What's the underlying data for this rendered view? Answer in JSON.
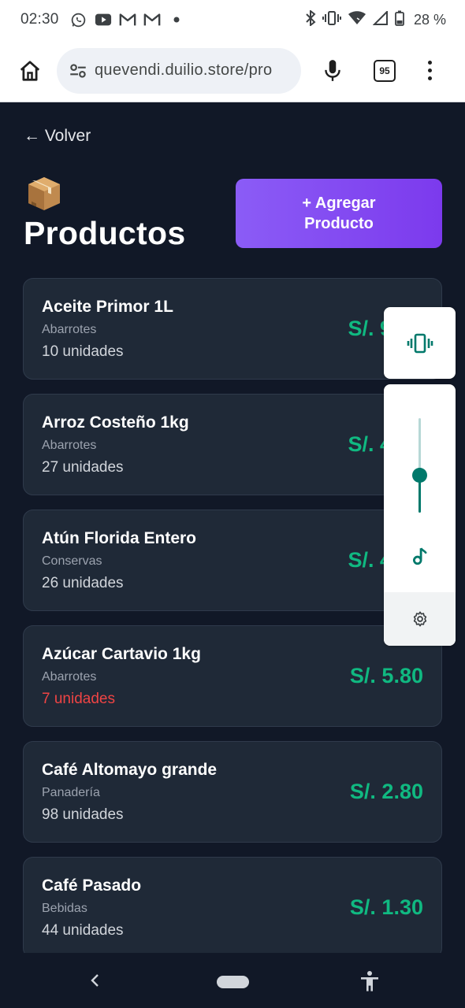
{
  "status_bar": {
    "time": "02:30",
    "battery": "28 %",
    "left_icons": [
      "whatsapp-icon",
      "youtube-icon",
      "gmail-icon",
      "gmail-icon",
      "dot-icon"
    ],
    "right_icons": [
      "bluetooth-icon",
      "vibrate-icon",
      "wifi-icon",
      "signal-icon",
      "battery-icon"
    ]
  },
  "browser": {
    "url": "quevendi.duilio.store/pro",
    "tab_count": "95"
  },
  "page": {
    "back_label": "← Volver",
    "title": "Productos",
    "add_button": "+ Agregar Producto"
  },
  "products": [
    {
      "name": "Aceite Primor 1L",
      "category": "Abarrotes",
      "stock": "10 unidades",
      "price": "S/. 9"
    },
    {
      "name": "Arroz Costeño 1kg",
      "category": "Abarrotes",
      "stock": "27 unidades",
      "price": "S/. 4"
    },
    {
      "name": "Atún Florida Entero",
      "category": "Conservas",
      "stock": "26 unidades",
      "price": "S/. 4"
    },
    {
      "name": "Azúcar Cartavio 1kg",
      "category": "Abarrotes",
      "stock": "7 unidades",
      "price": "S/. 5.80"
    },
    {
      "name": "Café Altomayo grande",
      "category": "Panadería",
      "stock": "98 unidades",
      "price": "S/. 2.80"
    },
    {
      "name": "Café Pasado",
      "category": "Bebidas",
      "stock": "44 unidades",
      "price": "S/. 1.30"
    }
  ],
  "volume_panel": {
    "level": 0.4
  },
  "colors": {
    "background": "#111827",
    "card": "#1f2937",
    "price": "#10b981",
    "low_stock": "#ef4444",
    "accent": "#7c3aed",
    "volume_accent": "#00796b"
  }
}
